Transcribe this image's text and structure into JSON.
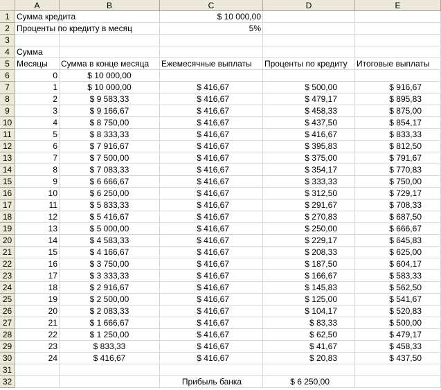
{
  "columns": [
    "A",
    "B",
    "C",
    "D",
    "E"
  ],
  "rows": [
    {
      "n": "1",
      "A": "Сумма кредита",
      "B": "",
      "C": "$ 10 000,00",
      "D": "",
      "E": ""
    },
    {
      "n": "2",
      "A": "Проценты по кредиту в месяц",
      "B": "",
      "C": "5%",
      "D": "",
      "E": ""
    },
    {
      "n": "3",
      "A": "",
      "B": "",
      "C": "",
      "D": "",
      "E": ""
    },
    {
      "n": "4",
      "A": "Сумма",
      "B": "",
      "C": "",
      "D": "",
      "E": ""
    },
    {
      "n": "5",
      "A": "Месяцы",
      "B": "Сумма в конце месяца",
      "C": "Ежемесячные выплаты",
      "D": "Проценты по кредиту",
      "E": "Итоговые выплаты"
    },
    {
      "n": "6",
      "A": "0",
      "B": "$ 10 000,00",
      "C": "",
      "D": "",
      "E": ""
    },
    {
      "n": "7",
      "A": "1",
      "B": "$ 10 000,00",
      "C": "$ 416,67",
      "D": "$ 500,00",
      "E": "$ 916,67"
    },
    {
      "n": "8",
      "A": "2",
      "B": "$ 9 583,33",
      "C": "$ 416,67",
      "D": "$ 479,17",
      "E": "$ 895,83"
    },
    {
      "n": "9",
      "A": "3",
      "B": "$ 9 166,67",
      "C": "$ 416,67",
      "D": "$ 458,33",
      "E": "$ 875,00"
    },
    {
      "n": "10",
      "A": "4",
      "B": "$ 8 750,00",
      "C": "$ 416,67",
      "D": "$ 437,50",
      "E": "$ 854,17"
    },
    {
      "n": "11",
      "A": "5",
      "B": "$ 8 333,33",
      "C": "$ 416,67",
      "D": "$ 416,67",
      "E": "$ 833,33"
    },
    {
      "n": "12",
      "A": "6",
      "B": "$ 7 916,67",
      "C": "$ 416,67",
      "D": "$ 395,83",
      "E": "$ 812,50"
    },
    {
      "n": "13",
      "A": "7",
      "B": "$ 7 500,00",
      "C": "$ 416,67",
      "D": "$ 375,00",
      "E": "$ 791,67"
    },
    {
      "n": "14",
      "A": "8",
      "B": "$ 7 083,33",
      "C": "$ 416,67",
      "D": "$ 354,17",
      "E": "$ 770,83"
    },
    {
      "n": "15",
      "A": "9",
      "B": "$ 6 666,67",
      "C": "$ 416,67",
      "D": "$ 333,33",
      "E": "$ 750,00"
    },
    {
      "n": "16",
      "A": "10",
      "B": "$ 6 250,00",
      "C": "$ 416,67",
      "D": "$ 312,50",
      "E": "$ 729,17"
    },
    {
      "n": "17",
      "A": "11",
      "B": "$ 5 833,33",
      "C": "$ 416,67",
      "D": "$ 291,67",
      "E": "$ 708,33"
    },
    {
      "n": "18",
      "A": "12",
      "B": "$ 5 416,67",
      "C": "$ 416,67",
      "D": "$ 270,83",
      "E": "$ 687,50"
    },
    {
      "n": "19",
      "A": "13",
      "B": "$ 5 000,00",
      "C": "$ 416,67",
      "D": "$ 250,00",
      "E": "$ 666,67"
    },
    {
      "n": "20",
      "A": "14",
      "B": "$ 4 583,33",
      "C": "$ 416,67",
      "D": "$ 229,17",
      "E": "$ 645,83"
    },
    {
      "n": "21",
      "A": "15",
      "B": "$ 4 166,67",
      "C": "$ 416,67",
      "D": "$ 208,33",
      "E": "$ 625,00"
    },
    {
      "n": "22",
      "A": "16",
      "B": "$ 3 750,00",
      "C": "$ 416,67",
      "D": "$ 187,50",
      "E": "$ 604,17"
    },
    {
      "n": "23",
      "A": "17",
      "B": "$ 3 333,33",
      "C": "$ 416,67",
      "D": "$ 166,67",
      "E": "$ 583,33"
    },
    {
      "n": "24",
      "A": "18",
      "B": "$ 2 916,67",
      "C": "$ 416,67",
      "D": "$ 145,83",
      "E": "$ 562,50"
    },
    {
      "n": "25",
      "A": "19",
      "B": "$ 2 500,00",
      "C": "$ 416,67",
      "D": "$ 125,00",
      "E": "$ 541,67"
    },
    {
      "n": "26",
      "A": "20",
      "B": "$ 2 083,33",
      "C": "$ 416,67",
      "D": "$ 104,17",
      "E": "$ 520,83"
    },
    {
      "n": "27",
      "A": "21",
      "B": "$ 1 666,67",
      "C": "$ 416,67",
      "D": "$ 83,33",
      "E": "$ 500,00"
    },
    {
      "n": "28",
      "A": "22",
      "B": "$ 1 250,00",
      "C": "$ 416,67",
      "D": "$ 62,50",
      "E": "$ 479,17"
    },
    {
      "n": "29",
      "A": "23",
      "B": "$ 833,33",
      "C": "$ 416,67",
      "D": "$ 41,67",
      "E": "$ 458,33"
    },
    {
      "n": "30",
      "A": "24",
      "B": "$ 416,67",
      "C": "$ 416,67",
      "D": "$ 20,83",
      "E": "$ 437,50"
    },
    {
      "n": "31",
      "A": "",
      "B": "",
      "C": "",
      "D": "",
      "E": ""
    },
    {
      "n": "32",
      "A": "",
      "B": "",
      "C": "Прибыль банка",
      "D": "$ 6 250,00",
      "E": ""
    }
  ]
}
